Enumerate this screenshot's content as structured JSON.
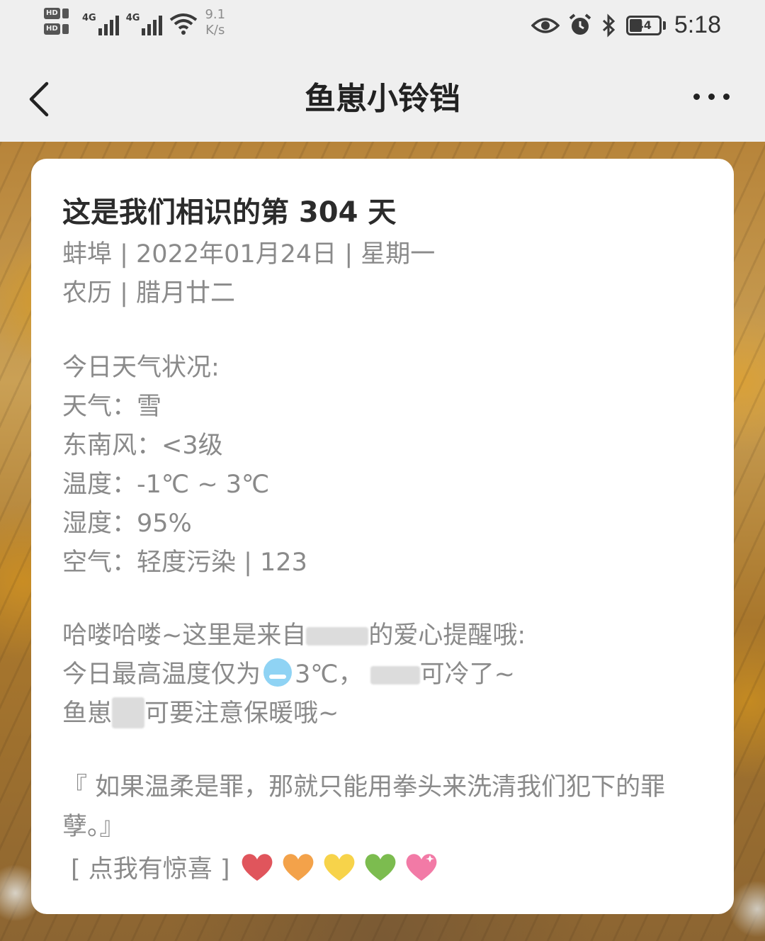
{
  "status_bar": {
    "network_label_1": "4G",
    "network_label_2": "4G",
    "speed_value": "9.1",
    "speed_unit": "K/s",
    "battery": "44",
    "time": "5:18"
  },
  "nav": {
    "title": "鱼崽小铃铛"
  },
  "card": {
    "title": "这是我们相识的第 304 天",
    "date_line": "蚌埠 | 2022年01月24日 | 星期一",
    "lunar_line": "农历 | 腊月廿二",
    "weather_header": "今日天气状况:",
    "weather": "天气：雪",
    "wind": "东南风：<3级",
    "temperature": "温度：-1℃ ~ 3℃",
    "humidity": "湿度：95%",
    "air": "空气：轻度污染 | 123",
    "reminder_1a": "哈喽哈喽~这里是来自",
    "reminder_1b": "的爱心提醒哦:",
    "reminder_2a": "今日最高温度仅为",
    "reminder_2b": "3℃，",
    "reminder_2c": "可冷了~",
    "reminder_3a": "鱼崽",
    "reminder_3b": "可要注意保暖哦~",
    "quote": "『 如果温柔是罪，那就只能用拳头来洗清我们犯下的罪孽。』",
    "surprise": "[ 点我有惊喜 ]"
  },
  "colors": {
    "heart_red": "#e0555c",
    "heart_orange": "#f3a24a",
    "heart_yellow": "#f7d34a",
    "heart_green": "#7cbc4f",
    "heart_pink": "#f27aa6"
  }
}
